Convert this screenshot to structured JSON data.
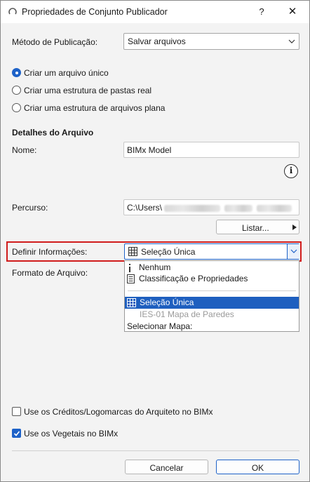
{
  "window": {
    "title": "Propriedades de Conjunto Publicador",
    "help": "?",
    "close": "✕"
  },
  "publish_method": {
    "label": "Método de Publicação:",
    "value": "Salvar arquivos"
  },
  "structure": {
    "options": [
      {
        "label": "Criar um arquivo único",
        "selected": true
      },
      {
        "label": "Criar uma estrutura de pastas real",
        "selected": false
      },
      {
        "label": "Criar uma estrutura de arquivos plana",
        "selected": false
      }
    ]
  },
  "file_details": {
    "heading": "Detalhes do Arquivo",
    "name_label": "Nome:",
    "name_value": "BIMx Model",
    "path_label": "Percurso:",
    "path_value": "C:\\Users\\",
    "list_button": "Listar...",
    "info_icon": "i"
  },
  "define_info": {
    "label": "Definir Informações:",
    "value": "Seleção Única"
  },
  "file_format": {
    "label": "Formato de Arquivo:"
  },
  "dropdown": {
    "items": [
      {
        "label": "Nenhum",
        "icon": "info-bar-icon",
        "state": "normal"
      },
      {
        "label": "Classificação e Propriedades",
        "icon": "document-icon",
        "state": "normal"
      },
      {
        "label": "Seleção Única",
        "icon": "grid-icon",
        "state": "selected"
      },
      {
        "label": "IES-01 Mapa de Paredes",
        "icon": "",
        "state": "disabled"
      },
      {
        "label": "Selecionar Mapa:",
        "icon": "",
        "state": "normal"
      }
    ]
  },
  "options": {
    "credits_label": "Use os Créditos/Logomarcas do Arquiteto no BIMx",
    "credits_checked": false,
    "vegetation_label": "Use os Vegetais no BIMx",
    "vegetation_checked": true
  },
  "footer": {
    "cancel": "Cancelar",
    "ok": "OK"
  },
  "colors": {
    "accent": "#1e62c8",
    "highlight": "#d01c1c"
  }
}
